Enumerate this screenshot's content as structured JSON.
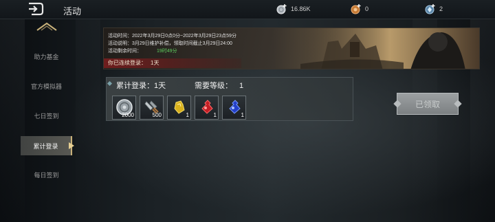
{
  "header": {
    "title": "活动",
    "currencies": [
      {
        "icon": "silver-coin-icon",
        "value": "16.86K",
        "color": "#c0c6cc"
      },
      {
        "icon": "copper-coin-icon",
        "value": "0",
        "color": "#d08a3c"
      },
      {
        "icon": "diamond-coin-icon",
        "value": "2",
        "color": "#8ab4d6"
      }
    ]
  },
  "sidebar": {
    "items": [
      {
        "label": "助力基金"
      },
      {
        "label": "官方模拟器"
      },
      {
        "label": "七日签到"
      },
      {
        "label": "累计登录"
      },
      {
        "label": "每日签到"
      }
    ],
    "active_index": 3
  },
  "event": {
    "time_line": "活动时间：2022年3月29日0点0分~2022年3月29日23点59分",
    "desc_line": "活动说明：3月29日维护补偿，领取时间截止3月29日24:00",
    "remain_label": "活动剩余时间：",
    "remain_value": "19时49分",
    "streak_label": "你已连续登录：",
    "streak_value": "1天"
  },
  "reward": {
    "cumulative_label": "累计登录：",
    "cumulative_value": "1天",
    "level_label": "需要等级：",
    "level_value": "1",
    "items": [
      {
        "icon": "silver-coin-icon",
        "qty": "2000"
      },
      {
        "icon": "sword-material-icon",
        "qty": "500"
      },
      {
        "icon": "yellow-potion-icon",
        "qty": "1"
      },
      {
        "icon": "red-potion-icon",
        "qty": "1"
      },
      {
        "icon": "blue-potion-icon",
        "qty": "1"
      }
    ],
    "button_label": "已领取"
  },
  "colors": {
    "accent_gold": "#c8b17a",
    "remain_green": "#5fd25f",
    "streak_red": "#781e1e"
  }
}
